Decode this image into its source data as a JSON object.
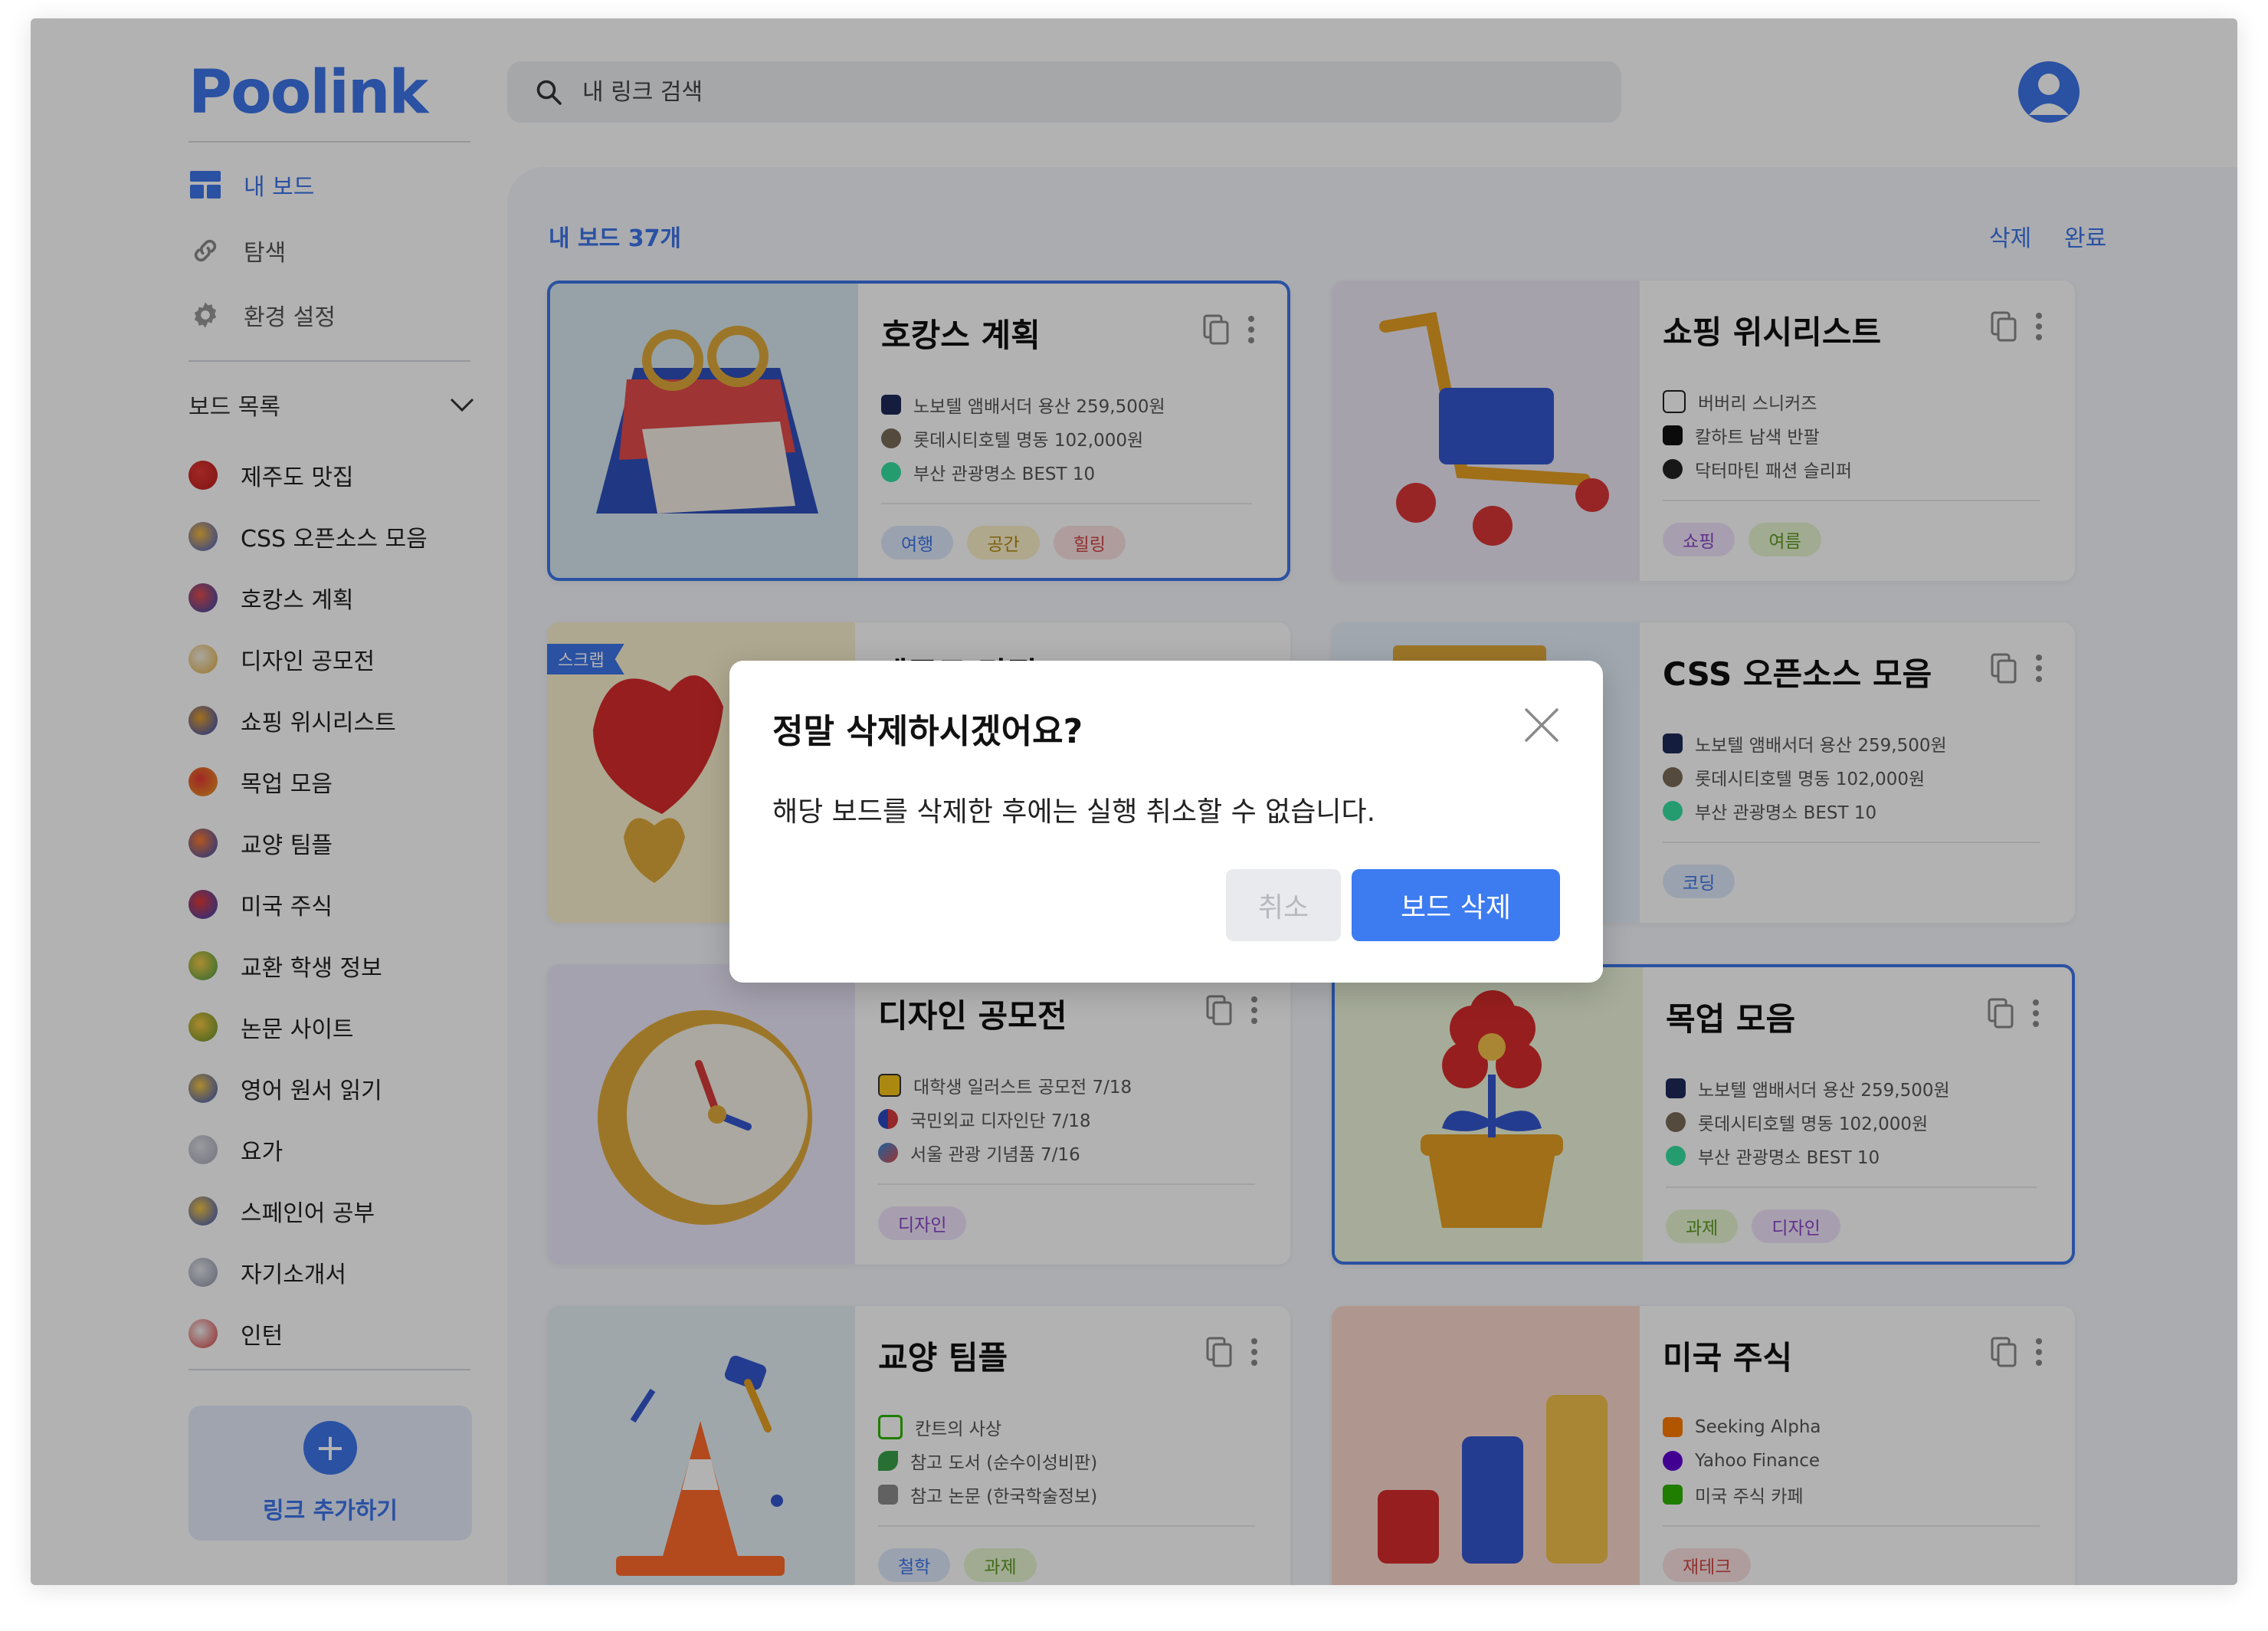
{
  "app": {
    "logo": "Poolink"
  },
  "search": {
    "placeholder": "내 링크 검색"
  },
  "nav": [
    {
      "label": "내 보드",
      "icon": "board-grid-icon",
      "active": true
    },
    {
      "label": "탐색",
      "icon": "link-icon",
      "active": false
    },
    {
      "label": "환경 설정",
      "icon": "gear-icon",
      "active": false
    }
  ],
  "sidebar": {
    "section_label": "보드 목록",
    "boards": [
      "제주도 맛집",
      "CSS 오픈소스 모음",
      "호캉스 계획",
      "디자인 공모전",
      "쇼핑 위시리스트",
      "목업 모음",
      "교양 팀플",
      "미국 주식",
      "교환 학생 정보",
      "논문 사이트",
      "영어 원서 읽기",
      "요가",
      "스페인어 공부",
      "자기소개서",
      "인턴"
    ],
    "add_link_label": "링크 추가하기"
  },
  "main": {
    "board_count": "내 보드 37개",
    "delete_label": "삭제",
    "done_label": "완료",
    "cards": [
      {
        "title": "호캉스 계획",
        "art": "calendar",
        "selected": true,
        "links": [
          "노보텔 앰배서더 용산 259,500원",
          "롯데시티호텔 명동 102,000원",
          "부산 관광명소 BEST 10"
        ],
        "tags": [
          "여행",
          "공간",
          "힐링"
        ]
      },
      {
        "title": "쇼핑 위시리스트",
        "art": "cart",
        "selected": false,
        "links": [
          "버버리 스니커즈",
          "칼하트 남색 반팔",
          "닥터마틴 패션 슬리퍼"
        ],
        "tags": [
          "쇼핑",
          "여름"
        ]
      },
      {
        "title": "제주도 맛집",
        "art": "hearts",
        "selected": false,
        "ribbon": "스크랩",
        "links": [],
        "tags": []
      },
      {
        "title": "CSS 오픈소스 모음",
        "art": "blocks",
        "selected": false,
        "links": [
          "노보텔 앰배서더 용산 259,500원",
          "롯데시티호텔 명동 102,000원",
          "부산 관광명소 BEST 10"
        ],
        "tags": [
          "코딩"
        ]
      },
      {
        "title": "디자인 공모전",
        "art": "clock",
        "selected": false,
        "links": [
          "대학생 일러스트 공모전 7/18",
          "국민외교 디자인단 7/18",
          "서울 관광 기념품 7/16"
        ],
        "tags": [
          "디자인"
        ]
      },
      {
        "title": "목업 모음",
        "art": "flower",
        "selected": true,
        "links": [
          "노보텔 앰배서더 용산 259,500원",
          "롯데시티호텔 명동 102,000원",
          "부산 관광명소 BEST 10"
        ],
        "tags": [
          "과제",
          "디자인"
        ]
      },
      {
        "title": "교양 팀플",
        "art": "cone",
        "selected": false,
        "links": [
          "칸트의 사상",
          "참고 도서 (순수이성비판)",
          "참고 논문 (한국학술정보)"
        ],
        "tags": [
          "철학",
          "과제"
        ]
      },
      {
        "title": "미국 주식",
        "art": "bars",
        "selected": false,
        "links": [
          "Seeking Alpha",
          "Yahoo Finance",
          "미국 주식 카페"
        ],
        "tags": [
          "재테크"
        ]
      }
    ]
  },
  "modal": {
    "title": "정말 삭제하시겠어요?",
    "message": "해당 보드를 삭제한 후에는 실행 취소할 수 없습니다.",
    "cancel_label": "취소",
    "confirm_label": "보드 삭제"
  },
  "colors": {
    "accent": "#3d74e8",
    "confirm_button": "#3d7bf0",
    "overlay": "rgba(0,0,0,0.30)"
  }
}
